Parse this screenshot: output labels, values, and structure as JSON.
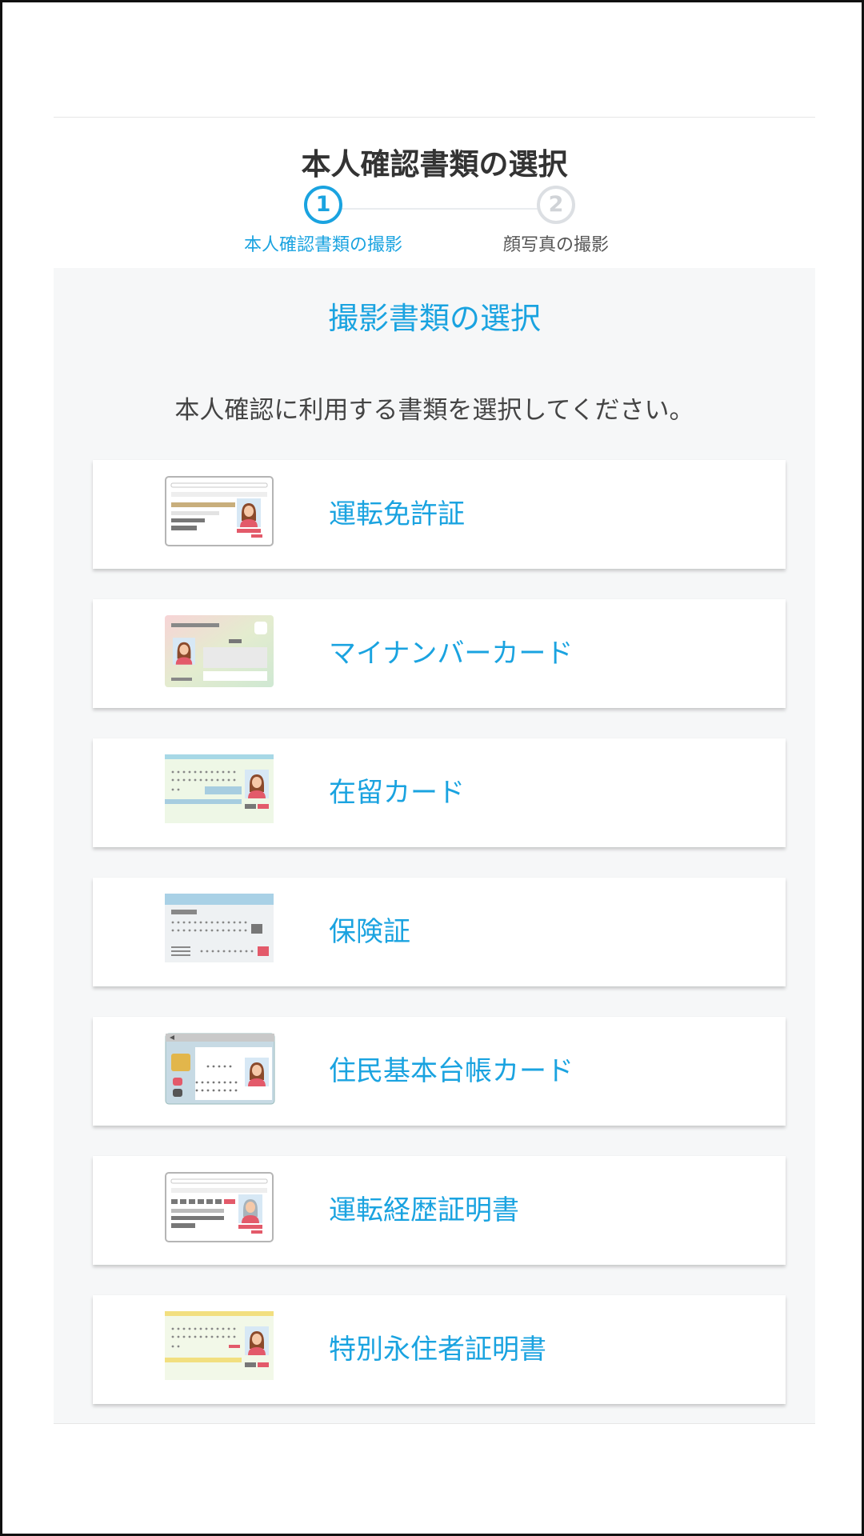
{
  "header": {
    "title": "本人確認書類の選択",
    "steps": [
      {
        "number": "1",
        "label": "本人確認書類の撮影",
        "active": true
      },
      {
        "number": "2",
        "label": "顔写真の撮影",
        "active": false
      }
    ]
  },
  "main": {
    "section_title": "撮影書類の選択",
    "instruction": "本人確認に利用する書類を選択してください。",
    "documents": [
      {
        "label": "運転免許証",
        "icon": "drivers-license-icon"
      },
      {
        "label": "マイナンバーカード",
        "icon": "my-number-card-icon"
      },
      {
        "label": "在留カード",
        "icon": "residence-card-icon"
      },
      {
        "label": "保険証",
        "icon": "health-insurance-card-icon"
      },
      {
        "label": "住民基本台帳カード",
        "icon": "resident-registry-card-icon"
      },
      {
        "label": "運転経歴証明書",
        "icon": "driving-history-certificate-icon"
      },
      {
        "label": "特別永住者証明書",
        "icon": "special-permanent-resident-certificate-icon"
      }
    ]
  },
  "colors": {
    "accent": "#1aa3e0",
    "title_text": "#333333",
    "content_bg": "#f6f7f8"
  }
}
